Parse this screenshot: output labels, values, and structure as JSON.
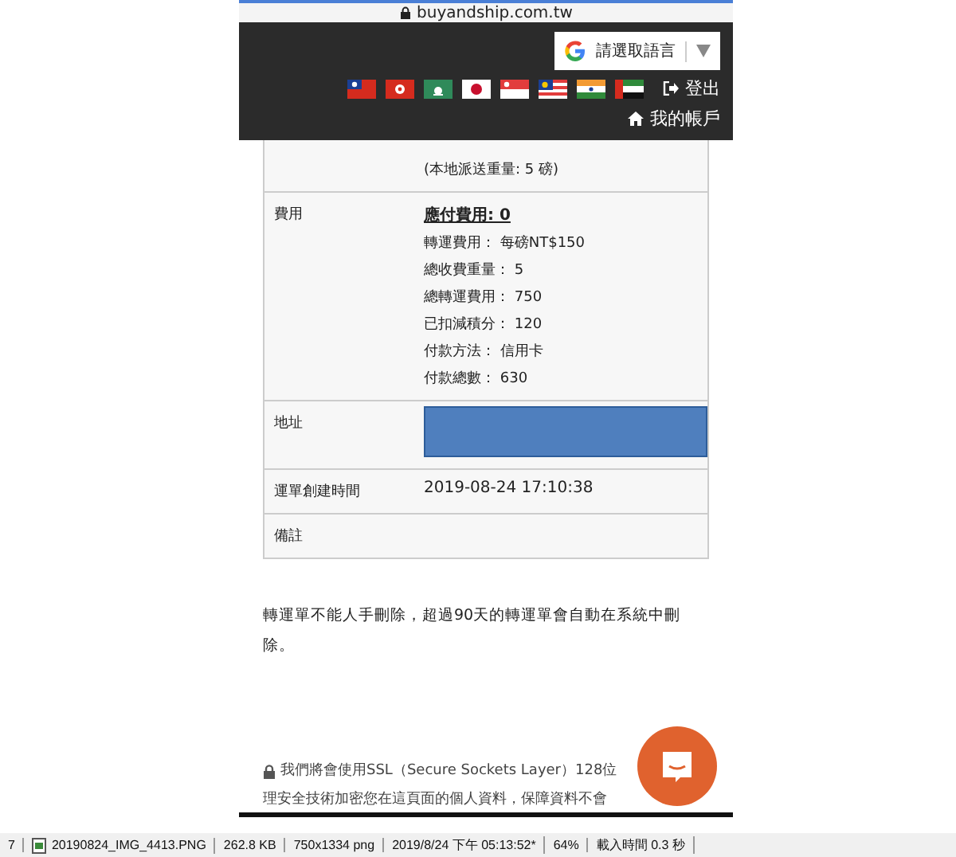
{
  "address_bar": {
    "url": "buyandship.com.tw"
  },
  "header": {
    "language_button": "請選取語言",
    "flags": [
      {
        "kind": "tw"
      },
      {
        "kind": "hk"
      },
      {
        "kind": "mo"
      },
      {
        "kind": "jp"
      },
      {
        "kind": "sg"
      },
      {
        "kind": "my"
      },
      {
        "kind": "in"
      },
      {
        "kind": "ae"
      }
    ],
    "logout": "登出",
    "account": "我的帳戶"
  },
  "details": [
    {
      "kind": "lines",
      "lines": [
        "(本地派送重量: 5 磅)"
      ]
    },
    {
      "kind": "fees",
      "label": "費用",
      "heading": "應付費用: 0",
      "lines": [
        "轉運費用： 每磅NT$150",
        "總收費重量： 5",
        "總轉運費用： 750",
        "已扣減積分： 120",
        "付款方法： 信用卡",
        "付款總數： 630"
      ]
    },
    {
      "kind": "redacted",
      "label": "地址"
    },
    {
      "kind": "value",
      "label": "運單創建時間",
      "value": "2019-08-24 17:10:38"
    },
    {
      "kind": "value",
      "label": "備註"
    }
  ],
  "note": "轉運單不能人手刪除，超過90天的轉運單會自動在系統中刪除。",
  "ssl_lines": [
    "我們將會使用SSL（Secure Sockets Layer）128位",
    "理安全技術加密您在這頁面的個人資料，保障資料不會"
  ],
  "status_bar": [
    "7",
    "20190824_IMG_4413.PNG",
    "262.8 KB",
    "750x1334 png",
    "2019/8/24 下午 05:13:52*",
    "64%",
    "載入時間 0.3 秒"
  ]
}
